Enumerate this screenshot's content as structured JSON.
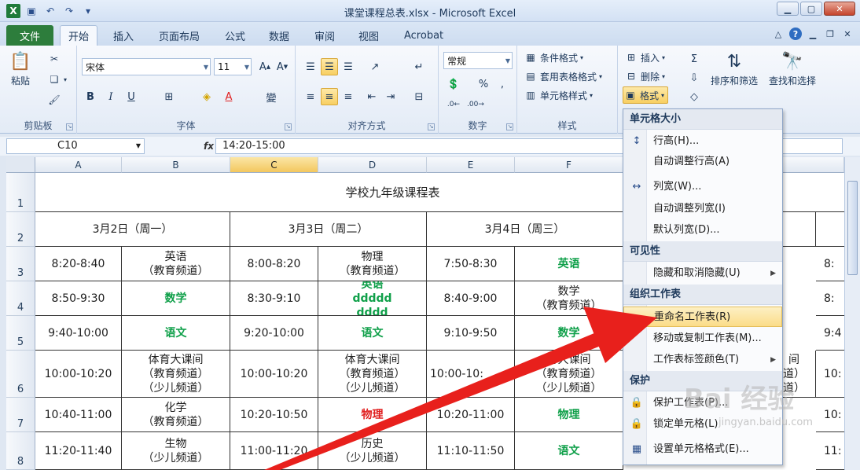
{
  "window": {
    "title": "课堂课程总表.xlsx - Microsoft Excel"
  },
  "tabs": {
    "file": "文件",
    "home": "开始",
    "insert": "插入",
    "layout": "页面布局",
    "formulas": "公式",
    "data": "数据",
    "review": "审阅",
    "view": "视图",
    "acrobat": "Acrobat"
  },
  "ribbon": {
    "clipboard": {
      "label": "剪贴板",
      "paste": "粘贴"
    },
    "font": {
      "label": "字体",
      "name": "宋体",
      "size": "11",
      "bold": "B",
      "italic": "I",
      "underline": "U"
    },
    "alignment": {
      "label": "对齐方式"
    },
    "number": {
      "label": "数字",
      "format": "常规",
      "percent": "%",
      "comma": ","
    },
    "styles": {
      "label": "样式",
      "conditional": "条件格式",
      "table": "套用表格格式",
      "cell": "单元格样式"
    },
    "cells": {
      "insert": "插入",
      "delete": "删除",
      "format": "格式"
    },
    "editing": {
      "sort_filter": "排序和筛选",
      "find_select": "查找和选择"
    }
  },
  "formula_bar": {
    "name_box": "C10",
    "fx": "fx",
    "content": "14:20-15:00"
  },
  "sheet": {
    "columns": [
      "A",
      "B",
      "C",
      "D",
      "E",
      "F"
    ],
    "selected_column": "C",
    "rows": [
      "1",
      "2",
      "3",
      "4",
      "5",
      "6",
      "7",
      "8"
    ],
    "title": "学校九年级课程表",
    "day_headers": [
      "3月2日（周一）",
      "3月3日（周二）",
      "3月4日（周三）"
    ],
    "r3": [
      "8:20-8:40",
      "英语\n（教育频道）",
      "8:00-8:20",
      "物理\n（教育频道）",
      "7:50-8:30",
      "英语",
      "8:"
    ],
    "r4": [
      "8:50-9:30",
      "数学",
      "8:30-9:10",
      "英语\nddddd\ndddd",
      "8:40-9:00",
      "数学\n（教育频道）",
      "8:"
    ],
    "r5": [
      "9:40-10:00",
      "语文",
      "9:20-10:00",
      "语文",
      "9:10-9:50",
      "数学",
      "9:4"
    ],
    "r6": [
      "10:00-10:20",
      "体育大课间\n（教育频道）\n（少儿频道）",
      "10:00-10:20",
      "体育大课间\n（教育频道）\n（少儿频道）",
      "10:00-10:",
      "育大课间\n（教育频道）\n（少儿频道）",
      "间\n道）\n道）",
      "10:"
    ],
    "r7": [
      "10:40-11:00",
      "化学\n（教育频道）",
      "10:20-10:50",
      "物理",
      "10:20-11:00",
      "物理",
      "10:"
    ],
    "r8": [
      "11:20-11:40",
      "生物\n（少儿频道）",
      "11:00-11:20",
      "历史\n（少儿频道）",
      "11:10-11:50",
      "语文",
      "11:"
    ]
  },
  "menu": {
    "h_size": "单元格大小",
    "row_height": "行高(H)...",
    "autofit_row": "自动调整行高(A)",
    "col_width": "列宽(W)...",
    "autofit_col": "自动调整列宽(I)",
    "default_width": "默认列宽(D)...",
    "h_visibility": "可见性",
    "hide_unhide": "隐藏和取消隐藏(U)",
    "h_organize": "组织工作表",
    "rename": "重命名工作表(R)",
    "move_copy": "移动或复制工作表(M)...",
    "tab_color": "工作表标签颜色(T)",
    "h_protect": "保护",
    "protect_sheet": "保护工作表(P)...",
    "lock_cell": "锁定单元格(L)",
    "format_cells": "设置单元格格式(E)..."
  },
  "watermark": {
    "brand": "Bai 经验",
    "url": "jingyan.baidu.com"
  },
  "colors": {
    "accent_green": "#10a04a",
    "accent_red": "#e01e1e",
    "file_tab": "#2d7d3c",
    "arrow": "#e8201c"
  }
}
